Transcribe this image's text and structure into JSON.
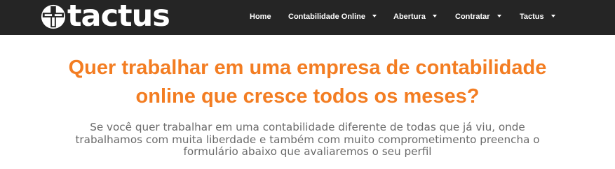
{
  "header": {
    "logo_text": "tactus",
    "nav": [
      {
        "label": "Home",
        "has_dropdown": false
      },
      {
        "label": "Contabilidade Online",
        "has_dropdown": true
      },
      {
        "label": "Abertura",
        "has_dropdown": true
      },
      {
        "label": "Contratar",
        "has_dropdown": true
      },
      {
        "label": "Tactus",
        "has_dropdown": true
      }
    ]
  },
  "main": {
    "headline_line1": "Quer trabalhar em uma empresa de contabilidade",
    "headline_line2": "online que cresce todos os meses?",
    "description_line1": "Se você quer trabalhar em uma contabilidade diferente de todas que já viu, onde",
    "description_line2": "trabalhamos com muita liberdade e também com muito comprometimento preencha o",
    "description_line3": "formulário abaixo que avaliaremos o seu perfil"
  },
  "colors": {
    "header_background": "#252525",
    "accent_orange": "#f37d22",
    "body_text": "#6b6b6b"
  }
}
